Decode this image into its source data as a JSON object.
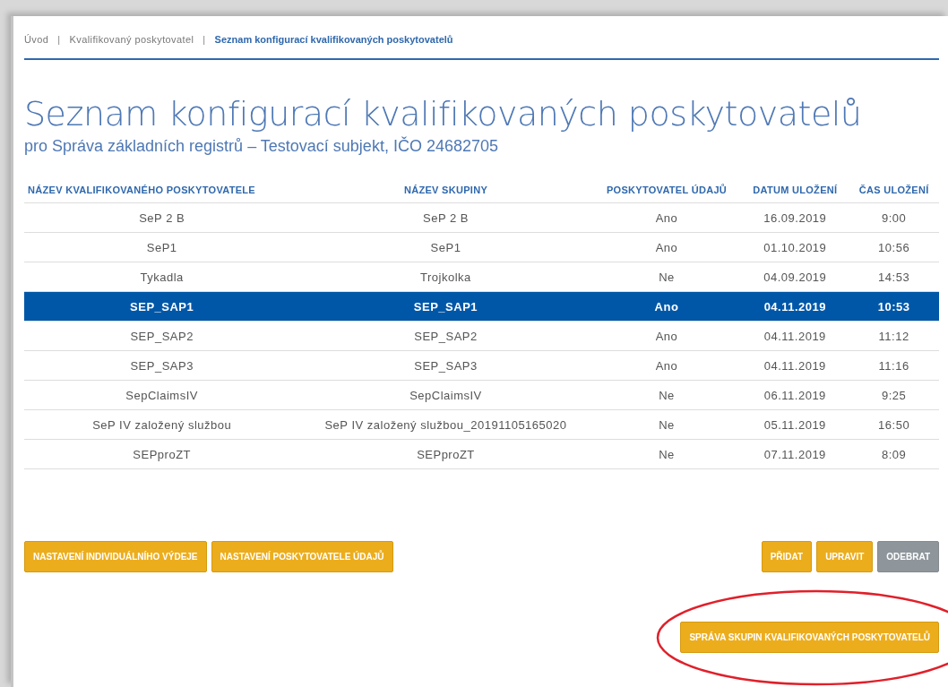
{
  "breadcrumb": [
    {
      "label": "Úvod",
      "current": false
    },
    {
      "label": "Kvalifikovaný poskytovatel",
      "current": false
    },
    {
      "label": "Seznam konfigurací kvalifikovaných poskytovatelů",
      "current": true
    }
  ],
  "breadcrumb_separator": "|",
  "title": "Seznam konfigurací kvalifikovaných poskytovatelů",
  "subtitle": "pro Správa základních registrů – Testovací subjekt, IČO 24682705",
  "table": {
    "columns": [
      "NÁZEV KVALIFIKOVANÉHO POSKYTOVATELE",
      "NÁZEV SKUPINY",
      "POSKYTOVATEL ÚDAJŮ",
      "DATUM ULOŽENÍ",
      "ČAS ULOŽENÍ"
    ],
    "rows": [
      {
        "cells": [
          "SeP 2 B",
          "SeP 2 B",
          "Ano",
          "16.09.2019",
          "9:00"
        ],
        "selected": false
      },
      {
        "cells": [
          "SeP1",
          "SeP1",
          "Ano",
          "01.10.2019",
          "10:56"
        ],
        "selected": false
      },
      {
        "cells": [
          "Tykadla",
          "Trojkolka",
          "Ne",
          "04.09.2019",
          "14:53"
        ],
        "selected": false
      },
      {
        "cells": [
          "SEP_SAP1",
          "SEP_SAP1",
          "Ano",
          "04.11.2019",
          "10:53"
        ],
        "selected": true
      },
      {
        "cells": [
          "SEP_SAP2",
          "SEP_SAP2",
          "Ano",
          "04.11.2019",
          "11:12"
        ],
        "selected": false
      },
      {
        "cells": [
          "SEP_SAP3",
          "SEP_SAP3",
          "Ano",
          "04.11.2019",
          "11:16"
        ],
        "selected": false
      },
      {
        "cells": [
          "SepClaimsIV",
          "SepClaimsIV",
          "Ne",
          "06.11.2019",
          "9:25"
        ],
        "selected": false
      },
      {
        "cells": [
          "SeP IV založený službou",
          "SeP IV založený službou_20191105165020",
          "Ne",
          "05.11.2019",
          "16:50"
        ],
        "selected": false
      },
      {
        "cells": [
          "SEPproZT",
          "SEPproZT",
          "Ne",
          "07.11.2019",
          "8:09"
        ],
        "selected": false
      }
    ]
  },
  "left_buttons": [
    {
      "label": "NASTAVENÍ INDIVIDUÁLNÍHO VÝDEJE",
      "disabled": false
    },
    {
      "label": "NASTAVENÍ POSKYTOVATELE ÚDAJŮ",
      "disabled": false
    }
  ],
  "right_buttons": [
    {
      "label": "PŘIDAT",
      "disabled": false
    },
    {
      "label": "UPRAVIT",
      "disabled": false
    },
    {
      "label": "ODEBRAT",
      "disabled": true
    }
  ],
  "bottom_button": {
    "label": "SPRÁVA SKUPIN KVALIFIKOVANÝCH POSKYTOVATELŮ",
    "disabled": false,
    "highlighted": true
  }
}
